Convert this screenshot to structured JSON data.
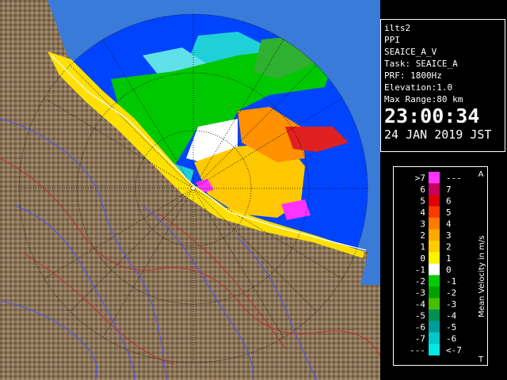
{
  "info": {
    "radar_name": "ilts2",
    "scan_mode": "PPI",
    "product": "SEAICE_A_V",
    "task": "Task: SEAICE_A",
    "prf": "PRF: 1800Hz",
    "elevation": "Elevation:1.0",
    "max_range": "Max Range:80 km",
    "time": "23:00:34",
    "date": "24 JAN 2019 JST"
  },
  "legend": {
    "title": "Mean Velocity in m/s",
    "corner_top": "A",
    "corner_bottom": "T",
    "bins": [
      {
        "left": ">7",
        "right": "---",
        "color": "#ff33ff"
      },
      {
        "left": "6",
        "right": "7",
        "color": "#c80060"
      },
      {
        "left": "5",
        "right": "6",
        "color": "#e00000"
      },
      {
        "left": "4",
        "right": "5",
        "color": "#ff3a00"
      },
      {
        "left": "3",
        "right": "4",
        "color": "#ff7a00"
      },
      {
        "left": "2",
        "right": "3",
        "color": "#ffa800"
      },
      {
        "left": "1",
        "right": "2",
        "color": "#ffcc00"
      },
      {
        "left": "0",
        "right": "1",
        "color": "#fff200"
      },
      {
        "left": "-1",
        "right": "0",
        "color": "#ffffff"
      },
      {
        "left": "-2",
        "right": "-1",
        "color": "#00cc00"
      },
      {
        "left": "-3",
        "right": "-2",
        "color": "#00a000"
      },
      {
        "left": "-4",
        "right": "-3",
        "color": "#44c000"
      },
      {
        "left": "-5",
        "right": "-4",
        "color": "#009050"
      },
      {
        "left": "-6",
        "right": "-5",
        "color": "#009c9c"
      },
      {
        "left": "-7",
        "right": "-6",
        "color": "#00c8c8"
      },
      {
        "left": "---",
        "right": "<-7",
        "color": "#00e8e8"
      }
    ]
  },
  "colors": {
    "background": "#000000",
    "sea_outside_range": "#3a7ad8",
    "no_echo_inside_range": "#0044ff",
    "land": "#8a7458",
    "river": "#5050ff",
    "boundary": "#c03030"
  },
  "icons": {
    "radar_site": "radar-site-icon"
  }
}
